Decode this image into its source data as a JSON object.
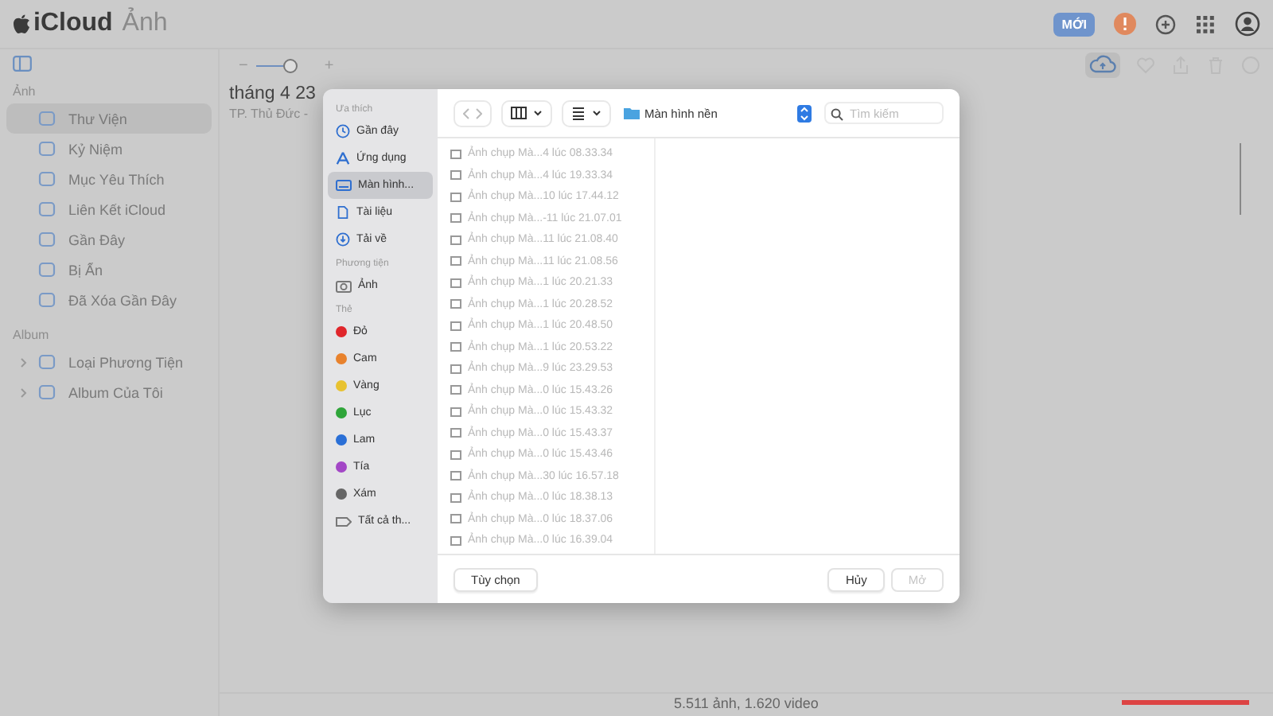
{
  "app_title": {
    "brand": "iCloud",
    "section": "Ảnh"
  },
  "header": {
    "badge": "MỚI"
  },
  "sidebar": {
    "sections": [
      {
        "title": "Ảnh",
        "items": [
          {
            "label": "Thư Viện",
            "selected": true
          },
          {
            "label": "Kỷ Niệm",
            "selected": false
          },
          {
            "label": "Mục Yêu Thích",
            "selected": false
          },
          {
            "label": "Liên Kết iCloud",
            "selected": false
          },
          {
            "label": "Gần Đây",
            "selected": false
          },
          {
            "label": "Bị Ẩn",
            "selected": false
          },
          {
            "label": "Đã Xóa Gần Đây",
            "selected": false
          }
        ]
      },
      {
        "title": "Album",
        "items": [
          {
            "label": "Loại Phương Tiện",
            "selected": false
          },
          {
            "label": "Album Của Tôi",
            "selected": false
          }
        ]
      }
    ]
  },
  "main": {
    "zoom": {
      "minus": "−",
      "plus": "+",
      "level": 0.55
    },
    "title": "tháng 4 23",
    "subtitle": "TP. Thủ Đức -",
    "footer": "5.511 ảnh, 1.620 video"
  },
  "dialog": {
    "sidebar": [
      {
        "title": "Ưa thích",
        "items": [
          {
            "label": "Gần đây",
            "kind": "clock",
            "selected": false
          },
          {
            "label": "Ứng dụng",
            "kind": "apps",
            "selected": false
          },
          {
            "label": "Màn hình...",
            "kind": "screen",
            "selected": true
          },
          {
            "label": "Tài liệu",
            "kind": "doc",
            "selected": false
          },
          {
            "label": "Tải về",
            "kind": "download",
            "selected": false
          }
        ]
      },
      {
        "title": "Phương tiện",
        "items": [
          {
            "label": "Ảnh",
            "kind": "photo",
            "selected": false
          }
        ]
      },
      {
        "title": "Thẻ",
        "items": [
          {
            "label": "Đỏ",
            "kind": "tag",
            "color": "#e0262b",
            "selected": false
          },
          {
            "label": "Cam",
            "kind": "tag",
            "color": "#e8822d",
            "selected": false
          },
          {
            "label": "Vàng",
            "kind": "tag",
            "color": "#e8c230",
            "selected": false
          },
          {
            "label": "Lục",
            "kind": "tag",
            "color": "#2fa53a",
            "selected": false
          },
          {
            "label": "Lam",
            "kind": "tag",
            "color": "#2a6fd6",
            "selected": false
          },
          {
            "label": "Tía",
            "kind": "tag",
            "color": "#a347c6",
            "selected": false
          },
          {
            "label": "Xám",
            "kind": "tag",
            "color": "#666666",
            "selected": false
          },
          {
            "label": "Tất cả th...",
            "kind": "alltags",
            "selected": false
          }
        ]
      }
    ],
    "location": "Màn hình nền",
    "search_placeholder": "Tìm kiếm",
    "files": [
      {
        "name": "Ảnh chụp Mà...4 lúc 08.33.34",
        "disabled": true
      },
      {
        "name": "Ảnh chụp Mà...4 lúc 19.33.34",
        "disabled": true
      },
      {
        "name": "Ảnh chụp Mà...10 lúc 17.44.12",
        "disabled": true
      },
      {
        "name": "Ảnh chụp Mà...-11 lúc 21.07.01",
        "disabled": true
      },
      {
        "name": "Ảnh chụp Mà...11 lúc 21.08.40",
        "disabled": true
      },
      {
        "name": "Ảnh chụp Mà...11 lúc 21.08.56",
        "disabled": true
      },
      {
        "name": "Ảnh chụp Mà...1 lúc 20.21.33",
        "disabled": true
      },
      {
        "name": "Ảnh chụp Mà...1 lúc 20.28.52",
        "disabled": true
      },
      {
        "name": "Ảnh chụp Mà...1 lúc 20.48.50",
        "disabled": true
      },
      {
        "name": "Ảnh chụp Mà...1 lúc 20.53.22",
        "disabled": true
      },
      {
        "name": "Ảnh chụp Mà...9 lúc 23.29.53",
        "disabled": true
      },
      {
        "name": "Ảnh chụp Mà...0 lúc 15.43.26",
        "disabled": true
      },
      {
        "name": "Ảnh chụp Mà...0 lúc 15.43.32",
        "disabled": true
      },
      {
        "name": "Ảnh chụp Mà...0 lúc 15.43.37",
        "disabled": true
      },
      {
        "name": "Ảnh chụp Mà...0 lúc 15.43.46",
        "disabled": true
      },
      {
        "name": "Ảnh chụp Mà...30 lúc 16.57.18",
        "disabled": true
      },
      {
        "name": "Ảnh chụp Mà...0 lúc 18.38.13",
        "disabled": true
      },
      {
        "name": "Ảnh chụp Mà...0 lúc 18.37.06",
        "disabled": true
      },
      {
        "name": "Ảnh chụp Mà...0 lúc 16.39.04",
        "disabled": true
      }
    ],
    "buttons": [
      {
        "label": "Tùy chọn",
        "disabled": false
      },
      {
        "label": "Hủy",
        "disabled": false
      },
      {
        "label": "Mở",
        "disabled": true
      }
    ]
  }
}
